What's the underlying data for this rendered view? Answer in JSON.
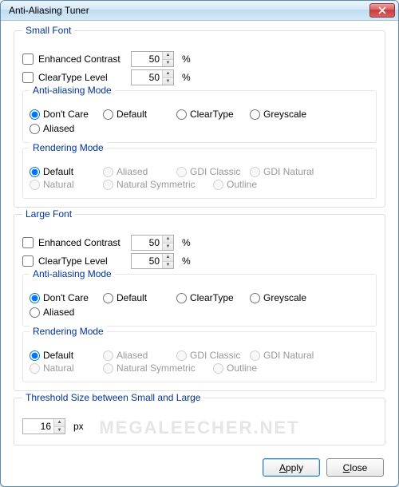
{
  "window": {
    "title": "Anti-Aliasing Tuner"
  },
  "small": {
    "legend": "Small Font",
    "enhanced_label": "Enhanced Contrast",
    "enhanced_value": "50",
    "enhanced_unit": "%",
    "cleartype_label": "ClearType Level",
    "cleartype_value": "50",
    "cleartype_unit": "%",
    "aa_legend": "Anti-aliasing Mode",
    "aa_options": [
      "Don't Care",
      "Default",
      "ClearType",
      "Greyscale",
      "Aliased"
    ],
    "aa_selected": 0,
    "render_legend": "Rendering Mode",
    "render_options_row1": [
      "Default",
      "Aliased",
      "GDI Classic",
      "GDI Natural"
    ],
    "render_options_row2": [
      "Natural",
      "Natural Symmetric",
      "Outline"
    ],
    "render_selected": 0
  },
  "large": {
    "legend": "Large Font",
    "enhanced_label": "Enhanced Contrast",
    "enhanced_value": "50",
    "enhanced_unit": "%",
    "cleartype_label": "ClearType Level",
    "cleartype_value": "50",
    "cleartype_unit": "%",
    "aa_legend": "Anti-aliasing Mode",
    "aa_options": [
      "Don't Care",
      "Default",
      "ClearType",
      "Greyscale",
      "Aliased"
    ],
    "aa_selected": 0,
    "render_legend": "Rendering Mode",
    "render_options_row1": [
      "Default",
      "Aliased",
      "GDI Classic",
      "GDI Natural"
    ],
    "render_options_row2": [
      "Natural",
      "Natural Symmetric",
      "Outline"
    ],
    "render_selected": 0
  },
  "threshold": {
    "legend": "Threshold Size between Small and Large",
    "value": "16",
    "unit": "px"
  },
  "buttons": {
    "apply": "Apply",
    "close": "Close"
  },
  "watermark": "MEGALEECHER.NET"
}
